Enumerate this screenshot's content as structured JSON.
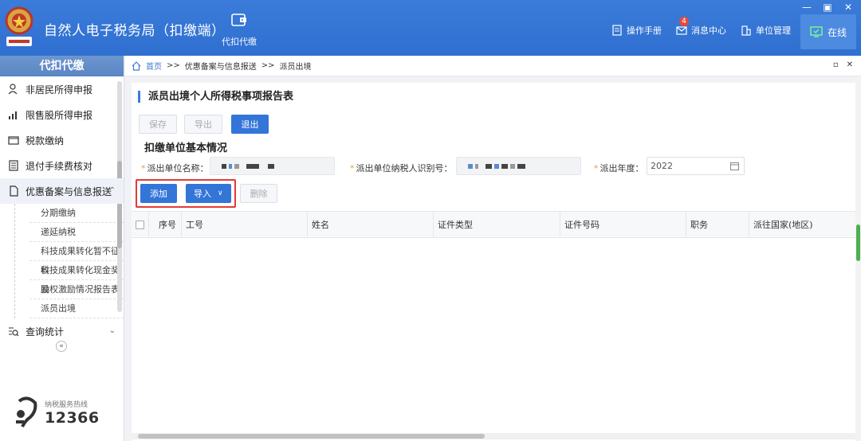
{
  "header": {
    "app_title": "自然人电子税务局（扣缴端）",
    "nav_label": "代扣代缴",
    "links": {
      "manual": "操作手册",
      "messages": "消息中心",
      "unit_mgmt": "单位管理"
    },
    "message_count": "4",
    "online_label": "在线",
    "window_controls": [
      "—",
      "▣",
      "✕"
    ],
    "brand_color": "#2f6fd0"
  },
  "sidebar": {
    "title": "代扣代缴",
    "items": [
      {
        "label": "非居民所得申报",
        "icon": "person-icon"
      },
      {
        "label": "限售股所得申报",
        "icon": "bar-chart-icon"
      },
      {
        "label": "税款缴纳",
        "icon": "folder-icon"
      },
      {
        "label": "退付手续费核对",
        "icon": "document-list-icon"
      },
      {
        "label": "优惠备案与信息报送",
        "icon": "document-icon"
      }
    ],
    "subitems": [
      "分期缴纳",
      "递延纳税",
      "科技成果转化暂不征收",
      "科技成果转化现金奖励",
      "股权激励情况报告表",
      "派员出境"
    ],
    "query_label": "查询统计",
    "collapse_glyph": "«",
    "hotline_label": "纳税服务热线",
    "hotline_number": "12366"
  },
  "breadcrumb": {
    "home": "首页",
    "sep": ">>",
    "level1": "优惠备案与信息报送",
    "level2": "派员出境"
  },
  "form": {
    "title": "派员出境个人所得税事项报告表",
    "buttons": {
      "save": "保存",
      "export": "导出",
      "exit": "退出"
    },
    "section_title": "扣缴单位基本情况",
    "fields": {
      "unit_name_label": "派出单位名称：",
      "taxpayer_id_label": "派出单位纳税人识别号：",
      "year_label": "派出年度：",
      "year_value": "2022"
    },
    "table_buttons": {
      "add": "添加",
      "import": "导入",
      "delete": "删除"
    },
    "columns": [
      "序号",
      "工号",
      "姓名",
      "证件类型",
      "证件号码",
      "职务",
      "派往国家(地区)"
    ]
  }
}
